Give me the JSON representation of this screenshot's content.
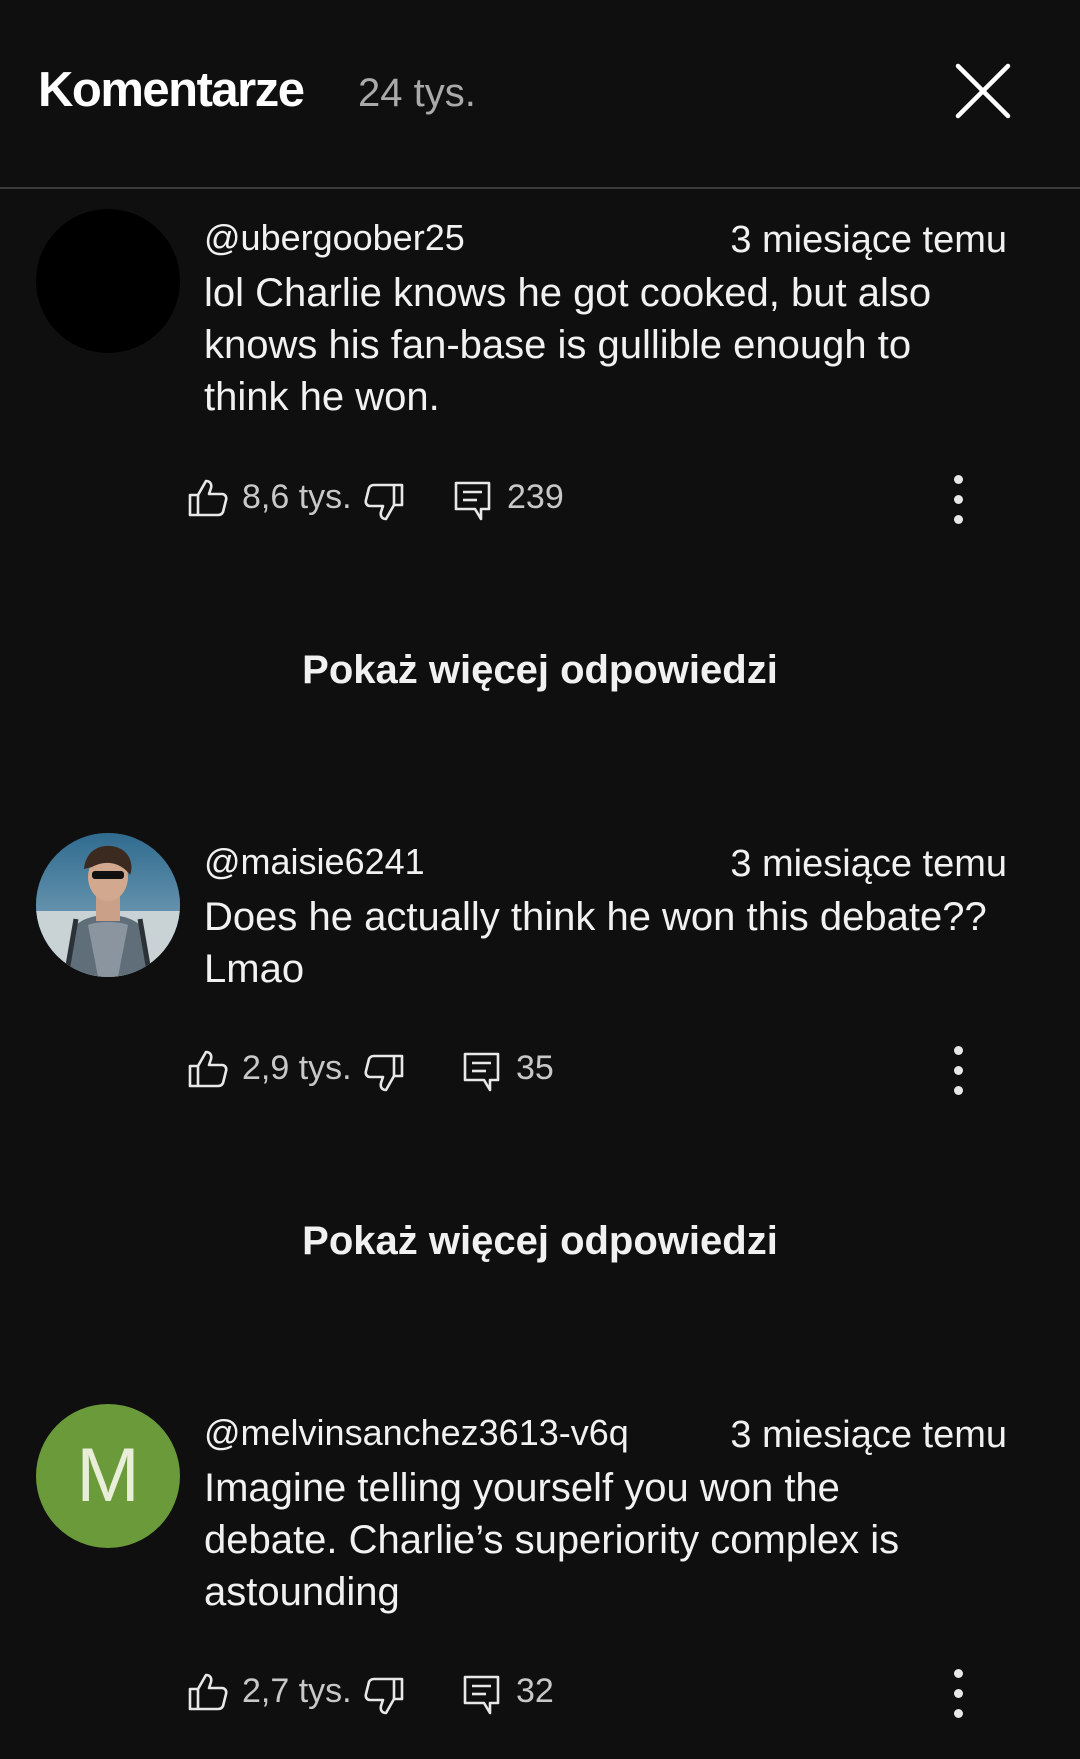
{
  "header": {
    "title": "Komentarze",
    "count": "24 tys."
  },
  "comments": [
    {
      "author": "@ubergoober25",
      "time": "3 miesiące temu",
      "text_lines": [
        "lol Charlie knows he got cooked, but also",
        "knows his fan-base is gullible enough to",
        "think he won."
      ],
      "likes": "8,6 tys.",
      "replies": "239",
      "avatar": {
        "kind": "blank",
        "color": "#000000"
      }
    },
    {
      "author": "@maisie6241",
      "time": "3 miesiące temu",
      "text_lines": [
        "Does he actually think he won this debate??",
        "Lmao"
      ],
      "likes": "2,9 tys.",
      "replies": "35",
      "avatar": {
        "kind": "photo"
      }
    },
    {
      "author": "@melvinsanchez3613-v6q",
      "time": "3 miesiące temu",
      "text_lines": [
        "Imagine telling yourself you won the",
        "debate. Charlie’s superiority complex is",
        "astounding"
      ],
      "likes": "2,7 tys.",
      "replies": "32",
      "avatar": {
        "kind": "letter",
        "letter": "M",
        "color": "#6a9a3a"
      }
    }
  ],
  "show_more_label": "Pokaż więcej odpowiedzi",
  "icons": {
    "close": "close-icon",
    "like": "thumbs-up-icon",
    "dislike": "thumbs-down-icon",
    "reply": "comment-icon",
    "more": "more-vert-icon"
  }
}
